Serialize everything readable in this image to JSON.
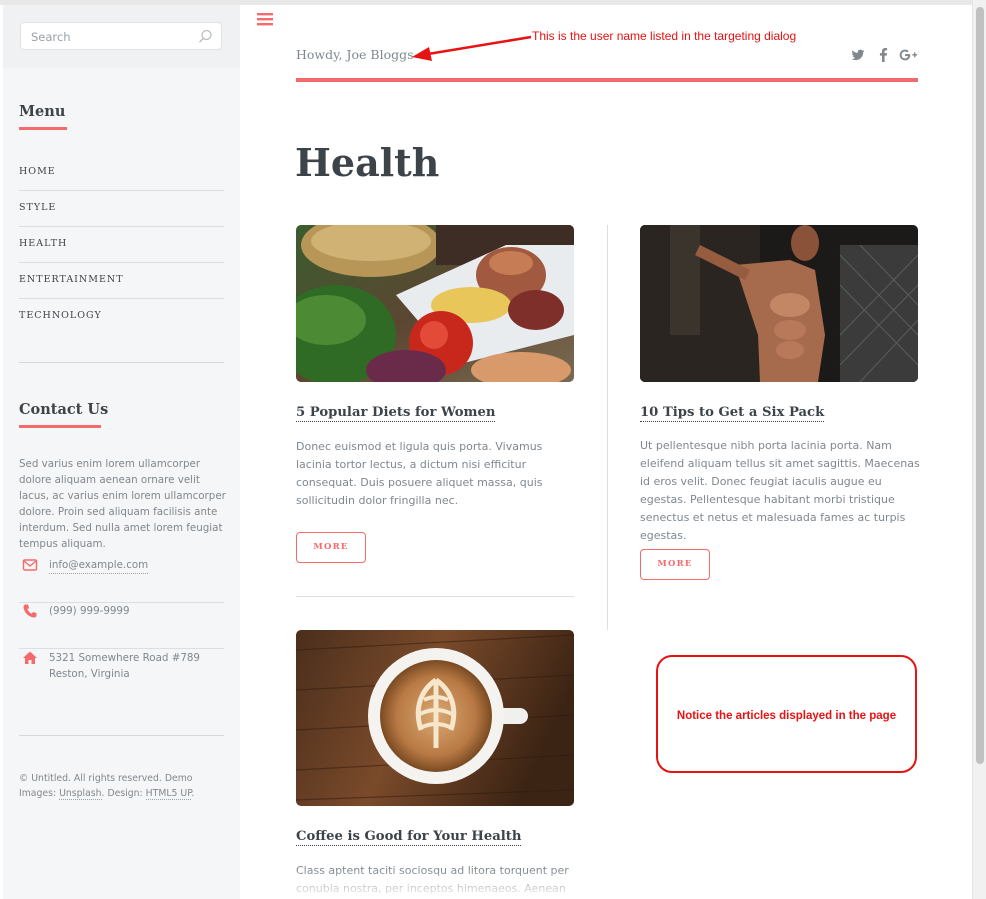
{
  "sidebar": {
    "search": {
      "placeholder": "Search"
    },
    "menu": {
      "heading": "Menu",
      "items": [
        "HOME",
        "STYLE",
        "HEALTH",
        "ENTERTAINMENT",
        "TECHNOLOGY"
      ]
    },
    "contact": {
      "heading": "Contact Us",
      "text": "Sed varius enim lorem ullamcorper dolore aliquam aenean ornare velit lacus, ac varius enim lorem ullamcorper dolore. Proin sed aliquam facilisis ante interdum. Sed nulla amet lorem feugiat tempus aliquam.",
      "email": "info@example.com",
      "phone": "(999) 999-9999",
      "address_line1": "5321 Somewhere Road #789",
      "address_line2": "Reston, Virginia"
    },
    "footer": {
      "copyright": "© Untitled. All rights reserved. Demo Images:",
      "unsplash": "Unsplash",
      "design_label": ". Design:",
      "html5up": "HTML5 UP",
      "end": "."
    }
  },
  "header": {
    "greeting": "Howdy, Joe Bloggs",
    "social_icons": [
      "twitter-icon",
      "facebook-icon",
      "google-plus-icon"
    ]
  },
  "annotations": {
    "user_note": "This is the user name listed in the targeting dialog",
    "articles_note": "Notice the articles displayed in the page"
  },
  "main": {
    "title": "Health",
    "articles": [
      {
        "title": "5 Popular Diets for Women",
        "text": "Donec euismod et ligula quis porta. Vivamus lacinia tortor lectus, a dictum nisi efficitur consequat. Duis posuere aliquet massa, quis sollicitudin dolor fringilla nec.",
        "button": "MORE",
        "image": "food-plate-photo"
      },
      {
        "title": "10 Tips to Get a Six Pack",
        "text": "Ut pellentesque nibh porta lacinia porta. Nam eleifend aliquam tellus sit amet sagittis. Maecenas id eros velit. Donec feugiat iaculis augue eu egestas. Pellentesque habitant morbi tristique senectus et netus et malesuada fames ac turpis egestas.",
        "button": "MORE",
        "image": "fitness-man-photo"
      },
      {
        "title": "Coffee is Good for Your Health",
        "text": "Class aptent taciti sociosqu ad litora torquent per conubia nostra, per inceptos himenaeos. Aenean",
        "image": "latte-coffee-photo"
      }
    ]
  },
  "colors": {
    "accent": "#f56a6a",
    "heading": "#3d4449",
    "body_text": "#7f888f",
    "annotation": "#e81212"
  }
}
